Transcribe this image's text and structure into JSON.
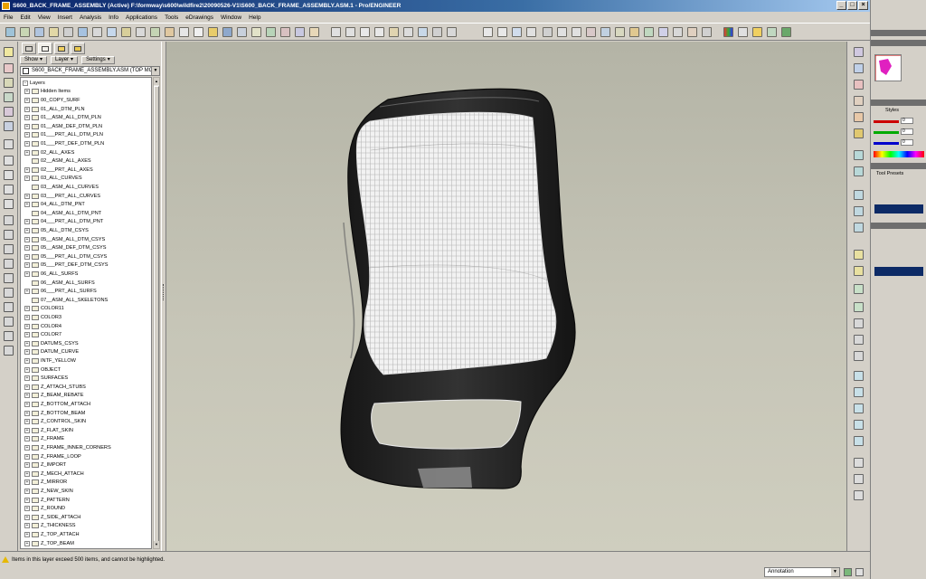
{
  "window": {
    "title": "S600_BACK_FRAME_ASSEMBLY (Active) F:\\formway\\s600\\wildfire2\\20090526-V1\\S600_BACK_FRAME_ASSEMBLY.ASM.1 - Pro/ENGINEER"
  },
  "menu": [
    "File",
    "Edit",
    "View",
    "Insert",
    "Analysis",
    "Info",
    "Applications",
    "Tools",
    "eDrawings",
    "Window",
    "Help"
  ],
  "tree": {
    "show_label": "Show",
    "layer_label": "Layer",
    "settings_label": "Settings",
    "selector_value": "S600_BACK_FRAME_ASSEMBLY.ASM (TOP MC",
    "root_label": "Layers",
    "items": [
      {
        "label": "Hidden Items",
        "expandable": true
      },
      {
        "label": "00_COPY_SURF",
        "expandable": true
      },
      {
        "label": "01_ALL_DTM_PLN",
        "expandable": true
      },
      {
        "label": "01__ASM_ALL_DTM_PLN",
        "expandable": true
      },
      {
        "label": "01__ASM_DEF_DTM_PLN",
        "expandable": true
      },
      {
        "label": "01___PRT_ALL_DTM_PLN",
        "expandable": true
      },
      {
        "label": "01___PRT_DEF_DTM_PLN",
        "expandable": true
      },
      {
        "label": "02_ALL_AXES",
        "expandable": true
      },
      {
        "label": "02__ASM_ALL_AXES",
        "expandable": false
      },
      {
        "label": "02___PRT_ALL_AXES",
        "expandable": true
      },
      {
        "label": "03_ALL_CURVES",
        "expandable": true
      },
      {
        "label": "03__ASM_ALL_CURVES",
        "expandable": false
      },
      {
        "label": "03___PRT_ALL_CURVES",
        "expandable": true
      },
      {
        "label": "04_ALL_DTM_PNT",
        "expandable": true
      },
      {
        "label": "04__ASM_ALL_DTM_PNT",
        "expandable": false
      },
      {
        "label": "04___PRT_ALL_DTM_PNT",
        "expandable": true
      },
      {
        "label": "05_ALL_DTM_CSYS",
        "expandable": true
      },
      {
        "label": "05__ASM_ALL_DTM_CSYS",
        "expandable": true
      },
      {
        "label": "05__ASM_DEF_DTM_CSYS",
        "expandable": true
      },
      {
        "label": "05___PRT_ALL_DTM_CSYS",
        "expandable": true
      },
      {
        "label": "05___PRT_DEF_DTM_CSYS",
        "expandable": true
      },
      {
        "label": "06_ALL_SURFS",
        "expandable": true
      },
      {
        "label": "06__ASM_ALL_SURFS",
        "expandable": false
      },
      {
        "label": "06___PRT_ALL_SURFS",
        "expandable": true
      },
      {
        "label": "07__ASM_ALL_SKELETONS",
        "expandable": false
      },
      {
        "label": "COLOR11",
        "expandable": true
      },
      {
        "label": "COLOR3",
        "expandable": true
      },
      {
        "label": "COLOR4",
        "expandable": true
      },
      {
        "label": "COLOR7",
        "expandable": true
      },
      {
        "label": "DATUMS_CSYS",
        "expandable": true
      },
      {
        "label": "DATUM_CURVE",
        "expandable": true
      },
      {
        "label": "INTF_YELLOW",
        "expandable": true
      },
      {
        "label": "OBJECT",
        "expandable": true
      },
      {
        "label": "SURFACES",
        "expandable": true
      },
      {
        "label": "Z_ATTACH_STUBS",
        "expandable": true
      },
      {
        "label": "Z_BEAM_REBATE",
        "expandable": true
      },
      {
        "label": "Z_BOTTOM_ATTACH",
        "expandable": true
      },
      {
        "label": "Z_BOTTOM_BEAM",
        "expandable": true
      },
      {
        "label": "Z_CONTROL_SKIN",
        "expandable": true
      },
      {
        "label": "Z_FLAT_SKIN",
        "expandable": true
      },
      {
        "label": "Z_FRAME",
        "expandable": true
      },
      {
        "label": "Z_FRAME_INNER_CORNERS",
        "expandable": true
      },
      {
        "label": "Z_FRAME_LOOP",
        "expandable": true
      },
      {
        "label": "Z_IMPORT",
        "expandable": true
      },
      {
        "label": "Z_MECH_ATTACH",
        "expandable": true
      },
      {
        "label": "Z_MIRROR",
        "expandable": true
      },
      {
        "label": "Z_NEW_SKIN",
        "expandable": true
      },
      {
        "label": "Z_PATTERN",
        "expandable": true
      },
      {
        "label": "Z_ROUND",
        "expandable": true
      },
      {
        "label": "Z_SIDE_ATTACH",
        "expandable": true
      },
      {
        "label": "Z_THICKNESS",
        "expandable": true
      },
      {
        "label": "Z_TOP_ATTACH",
        "expandable": true
      },
      {
        "label": "Z_TOP_BEAM",
        "expandable": true
      }
    ]
  },
  "status": {
    "message": "Items in this layer exceed 500 items, and cannot be highlighted.",
    "filter_value": "Annotation"
  },
  "side_panel": {
    "styles_tab": "Styles",
    "tool_presets_tab": "Tool Presets",
    "rgb_values": [
      "0",
      "0",
      "0"
    ]
  },
  "colors": {
    "title_start": "#0a246a",
    "title_end": "#a6caf0",
    "chrome": "#d4d0c8",
    "viewport": "#c6c5b7",
    "frame": "#1e1e1e",
    "mesh": "#ececec",
    "warning": "#e6b800"
  }
}
